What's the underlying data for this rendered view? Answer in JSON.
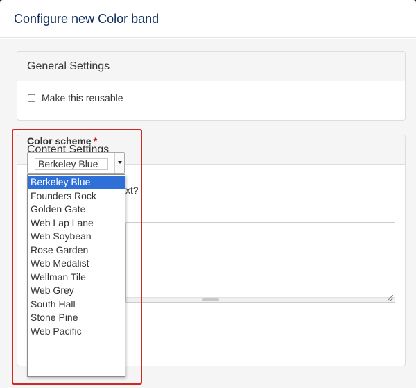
{
  "modal": {
    "title": "Configure new Color band"
  },
  "general_settings": {
    "heading": "General Settings",
    "reusable_label": "Make this reusable",
    "reusable_checked": false
  },
  "content_settings": {
    "heading": "Content Settings",
    "color_scheme": {
      "label": "Color scheme",
      "required_mark": "*",
      "selected_value": "Berkeley Blue",
      "options": [
        "Berkeley Blue",
        "Founders Rock",
        "Golden Gate",
        "Web Lap Lane",
        "Web Soybean",
        "Rose Garden",
        "Web Medalist",
        "Wellman Tile",
        "Web Grey",
        "South Hall",
        "Stone Pine",
        "Web Pacific"
      ]
    },
    "partial_text": "xt?"
  },
  "colors": {
    "title_color": "#0c2c5a",
    "highlight_border": "#d02822",
    "selected_option_bg": "#2f6fd8",
    "required_mark": "#c4161c"
  }
}
